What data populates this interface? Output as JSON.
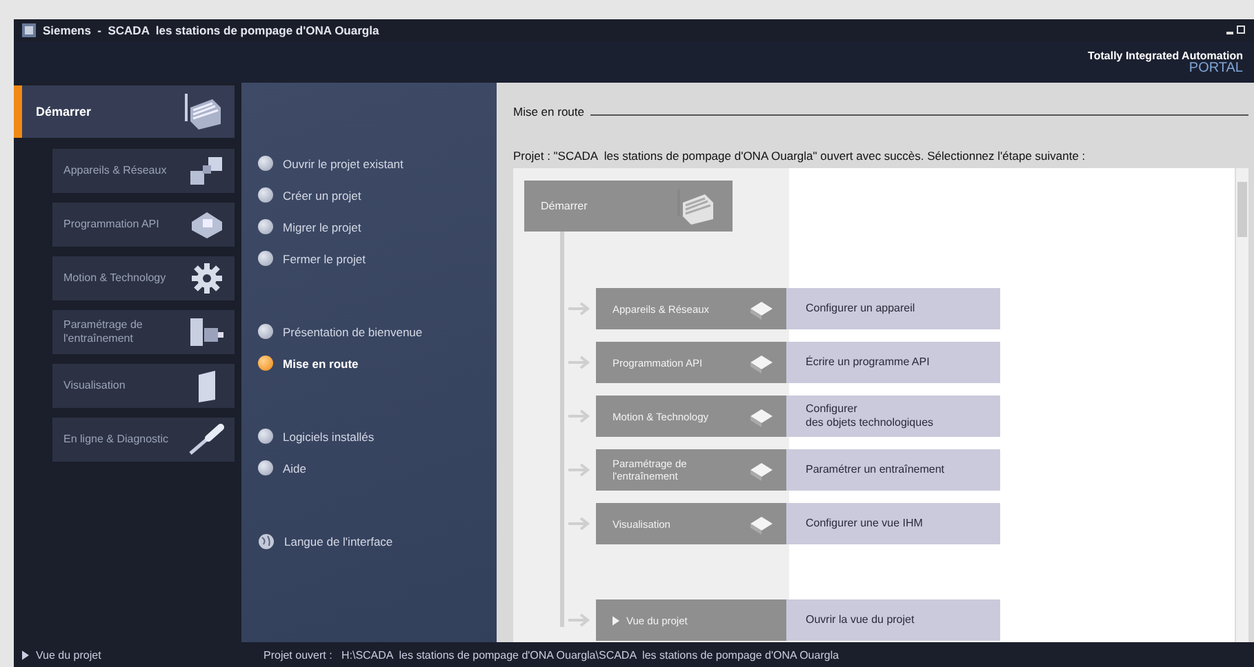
{
  "window": {
    "title": "Siemens  -  SCADA  les stations de pompage d'ONA Ouargla"
  },
  "header": {
    "brand_line": "Totally Integrated Automation",
    "brand_product": "PORTAL"
  },
  "sidebar": {
    "start": {
      "label": "Démarrer",
      "selected": true
    },
    "items": [
      {
        "label": "Appareils & Réseaux",
        "selected": false
      },
      {
        "label": "Programmation API",
        "selected": false
      },
      {
        "label": "Motion & Technology",
        "selected": false
      },
      {
        "label": "Paramétrage de l'entraînement",
        "selected": false
      },
      {
        "label": "Visualisation",
        "selected": false
      },
      {
        "label": "En ligne & Diagnostic",
        "selected": false
      }
    ]
  },
  "actions": [
    {
      "items": [
        {
          "label": "Ouvrir le projet existant",
          "kind": "bullet",
          "selected": false
        },
        {
          "label": "Créer un projet",
          "kind": "bullet",
          "selected": false
        },
        {
          "label": "Migrer le projet",
          "kind": "bullet",
          "selected": false
        },
        {
          "label": "Fermer le projet",
          "kind": "bullet",
          "selected": false
        }
      ]
    },
    {
      "items": [
        {
          "label": "Présentation de bienvenue",
          "kind": "bullet",
          "selected": false
        },
        {
          "label": "Mise en route",
          "kind": "bullet",
          "selected": true
        }
      ]
    },
    {
      "items": [
        {
          "label": "Logiciels installés",
          "kind": "bullet",
          "selected": false
        },
        {
          "label": "Aide",
          "kind": "bullet",
          "selected": false
        }
      ]
    },
    {
      "items": [
        {
          "label": "Langue de l'interface",
          "kind": "globe",
          "selected": false
        }
      ]
    }
  ],
  "content": {
    "title": "Mise en route",
    "message": "Projet : \"SCADA  les stations de pompage d'ONA Ouargla\" ouvert avec succès. Sélectionnez l'étape suivante :",
    "flow": {
      "start": "Démarrer",
      "steps": [
        {
          "portal": "Appareils & Réseaux",
          "action": "Configurer un appareil"
        },
        {
          "portal": "Programmation API",
          "action": "Écrire un programme API"
        },
        {
          "portal": "Motion & Technology",
          "action": "Configurer\ndes objets technologiques"
        },
        {
          "portal": "Paramétrage de l'entraînement",
          "action": "Paramétrer un entraînement"
        },
        {
          "portal": "Visualisation",
          "action": "Configurer une vue IHM"
        }
      ],
      "project_view": {
        "label": "Vue du projet",
        "action": "Ouvrir la vue du projet"
      }
    }
  },
  "footer": {
    "project_view": "Vue du projet",
    "status": "Projet ouvert :   H:\\SCADA  les stations de pompage d'ONA Ouargla\\SCADA  les stations de pompage d'ONA Ouargla"
  }
}
